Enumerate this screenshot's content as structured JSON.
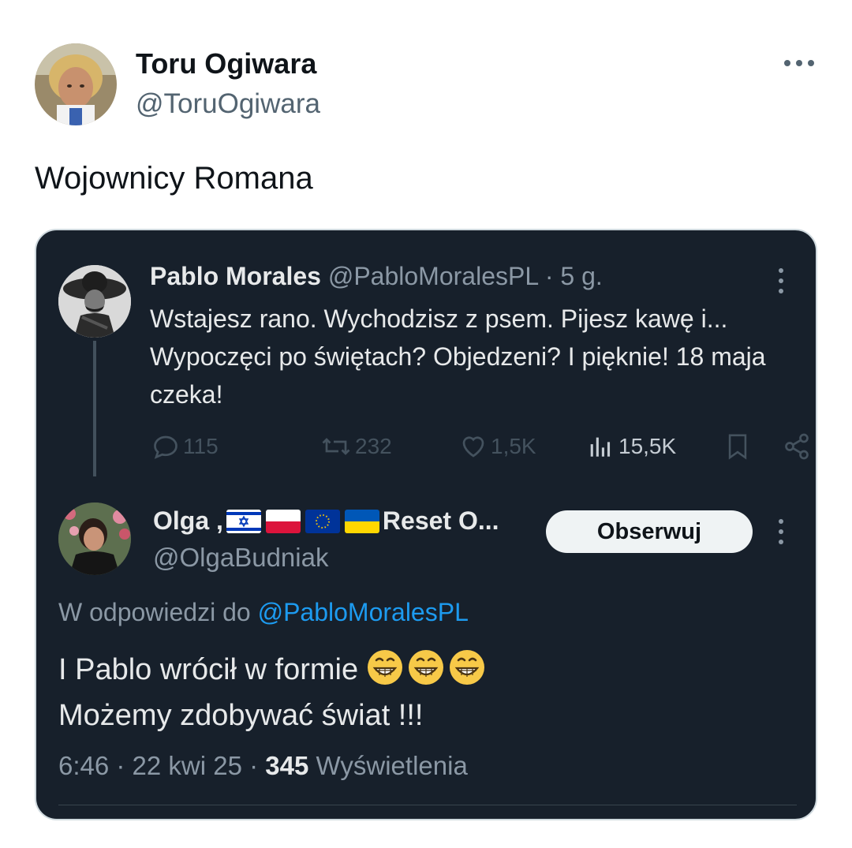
{
  "tweet": {
    "author_name": "Toru Ogiwara",
    "author_handle": "@ToruOgiwara",
    "text": "Wojownicy Romana",
    "more_icon": "ellipsis-icon"
  },
  "embedded": {
    "original": {
      "author_name": "Pablo Morales",
      "meta": "@PabloMoralesPL · 5 g.",
      "text": "Wstajesz rano. Wychodzisz z psem. Pijesz kawę i... Wypoczęci po świętach? Objedzeni? I pięknie! 18 maja czeka!",
      "stats": {
        "replies": "115",
        "reposts": "232",
        "likes": "1,5K",
        "views": "15,5K"
      }
    },
    "reply": {
      "author_name_prefix": "Olga ,",
      "author_name_suffix": "Reset O...",
      "flags": [
        "israel-flag",
        "poland-flag",
        "eu-flag",
        "ukraine-flag"
      ],
      "author_handle": "@OlgaBudniak",
      "follow_label": "Obserwuj",
      "reply_to_prefix": "W odpowiedzi do ",
      "reply_to_handle": "@PabloMoralesPL",
      "line1": "I Pablo wrócił w formie",
      "line2": "Możemy zdobywać świat !!!",
      "emoji_count": 3,
      "time": "6:46 · 22 kwi 25 · ",
      "views_count": "345",
      "views_label": " Wyświetlenia"
    }
  },
  "colors": {
    "card_bg": "#17202b",
    "link": "#1d9bf0",
    "muted": "#8b98a5"
  }
}
